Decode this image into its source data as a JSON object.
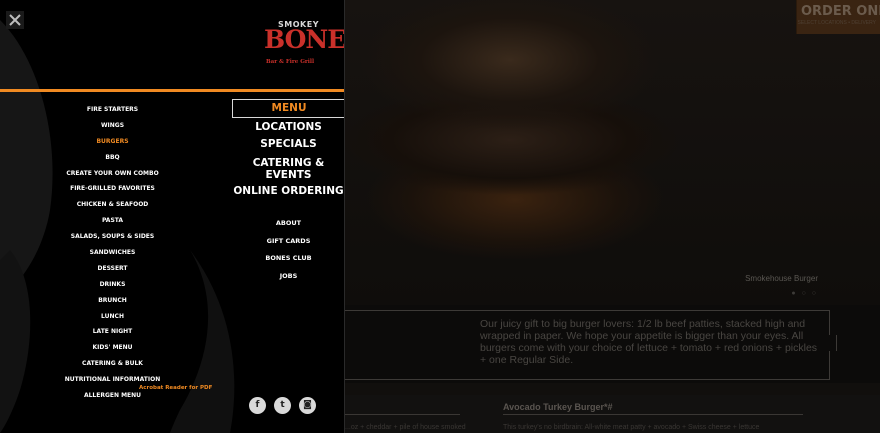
{
  "background": {
    "order_button": "ORDER ONLINE",
    "order_sub": "SELECT LOCATIONS • DELIVERY",
    "hero_caption": "Smokehouse Burger",
    "hero_dots": "● ○ ○",
    "description": "Our juicy gift to big burger lovers: 1/2 lb beef patties, stacked high and wrapped in paper. We hope your appetite is bigger than your eyes. All burgers come with your choice of lettuce + tomato + red onions + pickles + one Regular Side.",
    "lower_left_text": "...oz + cheddar + pile of house smoked",
    "lower_title": "Avocado Turkey Burger*#",
    "lower_right_text": "This turkey's no birdbrain: All-white meat patty + avocado + Swiss cheese + lettuce"
  },
  "panel": {
    "logo": {
      "top": "SMOKEY",
      "main": "BONES",
      "tagline": "Bar & Fire Grill"
    },
    "menu_items": [
      "FIRE STARTERS",
      "WINGS",
      "BURGERS",
      "BBQ",
      "CREATE YOUR OWN COMBO",
      "FIRE-GRILLED FAVORITES",
      "CHICKEN & SEAFOOD",
      "PASTA",
      "SALADS, SOUPS & SIDES",
      "SANDWICHES",
      "DESSERT",
      "DRINKS",
      "BRUNCH",
      "LUNCH",
      "LATE NIGHT",
      "KIDS' MENU",
      "CATERING & BULK",
      "NUTRITIONAL INFORMATION",
      "ALLERGEN MENU"
    ],
    "pdf_note": "Acrobat Reader for PDF",
    "main_nav": [
      "MENU",
      "LOCATIONS",
      "SPECIALS",
      "CATERING &",
      "EVENTS",
      "ONLINE ORDERING"
    ],
    "sub_nav": [
      "ABOUT",
      "GIFT CARDS",
      "BONES CLUB",
      "JOBS"
    ],
    "social": {
      "facebook": "f",
      "twitter": "t",
      "instagram": "◙"
    }
  },
  "colors": {
    "accent": "#f08a22",
    "brand_red": "#c9302a",
    "panel_bg": "#000000"
  }
}
